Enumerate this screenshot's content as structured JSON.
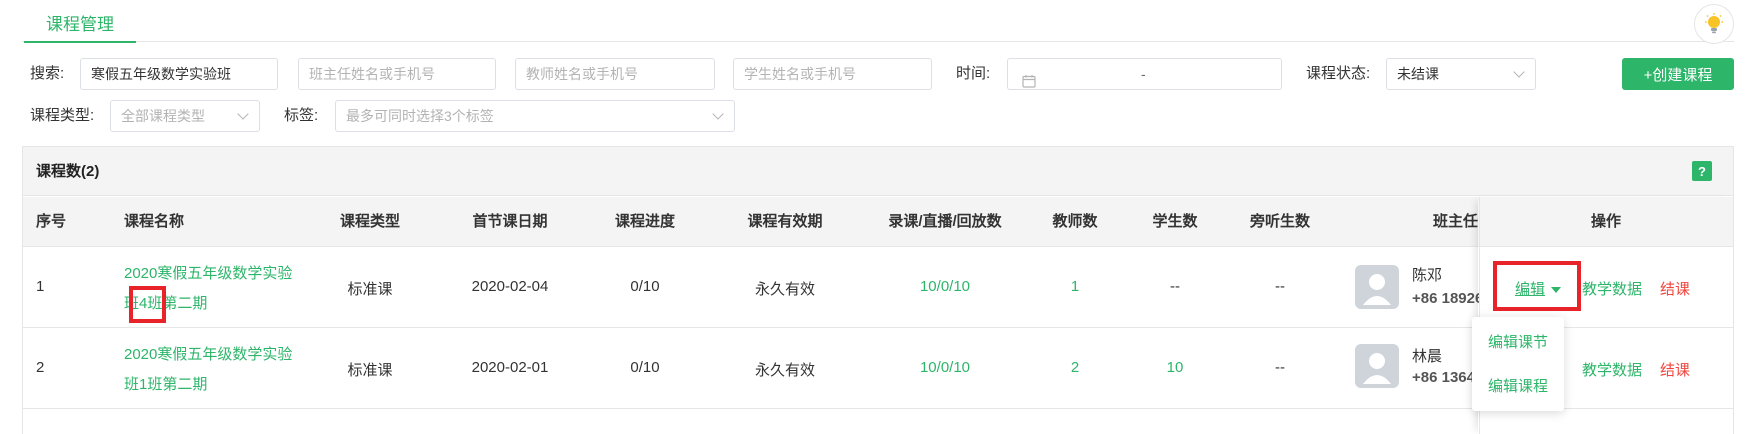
{
  "header": {
    "tab_title": "课程管理"
  },
  "filters": {
    "search_label": "搜索:",
    "search_value": "寒假五年级数学实验班",
    "head_teacher_placeholder": "班主任姓名或手机号",
    "teacher_placeholder": "教师姓名或手机号",
    "student_placeholder": "学生姓名或手机号",
    "time_label": "时间:",
    "time_separator": "-",
    "status_label": "课程状态:",
    "status_value": "未结课",
    "type_label": "课程类型:",
    "type_value": "全部课程类型",
    "tag_label": "标签:",
    "tag_placeholder": "最多可同时选择3个标签",
    "create_button": "+创建课程"
  },
  "table": {
    "count_label": "课程数(2)",
    "help_label": "?",
    "headers": [
      "序号",
      "课程名称",
      "课程类型",
      "首节课日期",
      "课程进度",
      "课程有效期",
      "录课/直播/回放数",
      "教师数",
      "学生数",
      "旁听生数",
      "班主任",
      "操作"
    ],
    "rows": [
      {
        "index": "1",
        "name_line1": "2020寒假五年级数学实验",
        "name_line2_a": "班",
        "name_line2_b": "4",
        "name_line2_c": "班第二期",
        "type": "标准课",
        "first_date": "2020-02-04",
        "progress": "0/10",
        "validity": "永久有效",
        "record_live_replay": "10/0/10",
        "teachers": "1",
        "students": "--",
        "auditors": "--",
        "head_teacher_name": "陈邓",
        "head_teacher_phone": "+86 18926",
        "action_edit": "编辑",
        "action_data": "教学数据",
        "action_end": "结课"
      },
      {
        "index": "2",
        "name_line1": "2020寒假五年级数学实验",
        "name_line2": "班1班第二期",
        "type": "标准课",
        "first_date": "2020-02-01",
        "progress": "0/10",
        "validity": "永久有效",
        "record_live_replay": "10/0/10",
        "teachers": "2",
        "students": "10",
        "auditors": "--",
        "head_teacher_name": "林晨",
        "head_teacher_phone": "+86 1364",
        "action_data": "教学数据",
        "action_end": "结课"
      }
    ],
    "edit_menu": [
      "编辑课节",
      "编辑课程"
    ]
  },
  "colors": {
    "accent": "#2db56a",
    "danger": "#f2453d",
    "highlight": "#e8232a"
  }
}
